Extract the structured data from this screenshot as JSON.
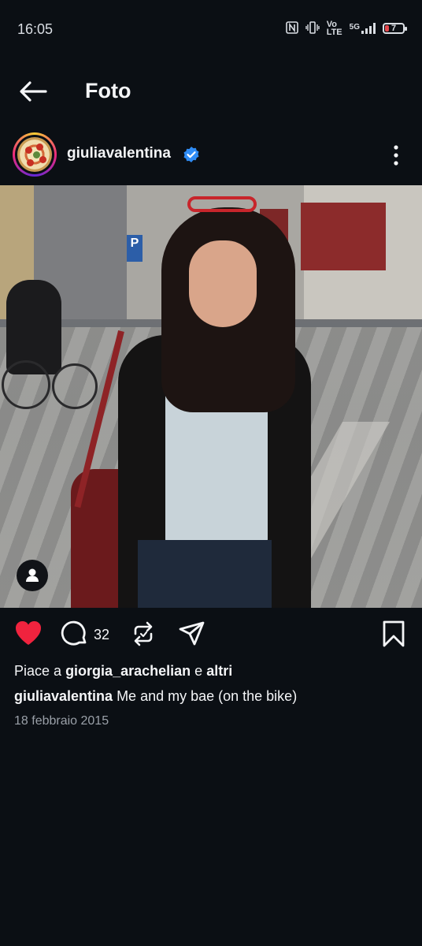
{
  "status_bar": {
    "time": "16:05",
    "nfc_icon": "nfc-icon",
    "vibrate_icon": "vibrate-icon",
    "volte_label_top": "Vo",
    "volte_label_bottom": "LTE",
    "network_label": "5G",
    "battery_level": "7",
    "battery_color": "#e5484d"
  },
  "header": {
    "back_icon": "arrow-left-icon",
    "title": "Foto"
  },
  "post": {
    "username": "giuliavalentina",
    "verified_color": "#2f8cf5",
    "more_icon": "more-vertical-icon",
    "photo_alt": "photo",
    "user_tag_icon": "person-icon"
  },
  "actions": {
    "like_icon": "heart-icon",
    "like_color": "#f0233e",
    "comment_icon": "comment-icon",
    "comment_count": "32",
    "repost_icon": "repost-icon",
    "share_icon": "share-icon",
    "save_icon": "bookmark-icon"
  },
  "likes": {
    "prefix": "Piace a",
    "user": "giorgia_arachelian",
    "conjunction": "e",
    "others": "altri"
  },
  "caption": {
    "username": "giuliavalentina",
    "text": "Me and my bae (on the bike)"
  },
  "date": "18 febbraio 2015"
}
